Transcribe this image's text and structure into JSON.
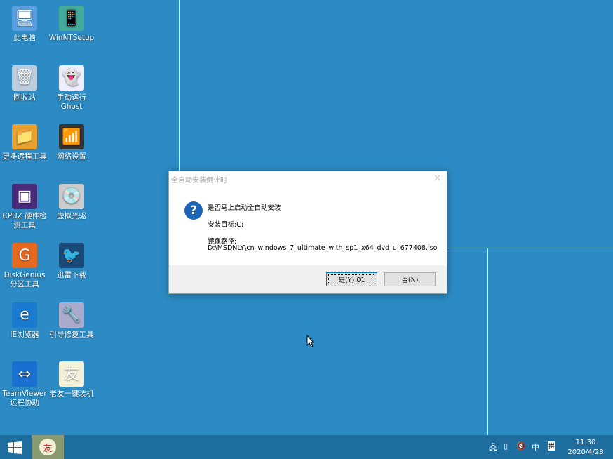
{
  "desktop_icons": [
    {
      "label": "此电脑",
      "glyph": "🖥"
    },
    {
      "label": "WinNTSetup",
      "glyph": "📱"
    },
    {
      "label": "回收站",
      "glyph": "🗑"
    },
    {
      "label": "手动运行Ghost",
      "glyph": "👻"
    },
    {
      "label": "更多远程工具",
      "glyph": "📁"
    },
    {
      "label": "网络设置",
      "glyph": "📶"
    },
    {
      "label": "CPUZ 硬件检测工具",
      "glyph": "▣"
    },
    {
      "label": "虚拟光驱",
      "glyph": "💿"
    },
    {
      "label": "DiskGenius分区工具",
      "glyph": "G"
    },
    {
      "label": "迅雷下载",
      "glyph": "🐦"
    },
    {
      "label": "IE浏览器",
      "glyph": "e"
    },
    {
      "label": "引导修复工具",
      "glyph": "🔧"
    },
    {
      "label": "TeamViewer远程协助",
      "glyph": "⇔"
    },
    {
      "label": "老友一键装机",
      "glyph": "友"
    }
  ],
  "dialog": {
    "title": "全自动安装倒计时",
    "close": "✕",
    "question": "是否马上启动全自动安装",
    "target": "安装目标:C:",
    "image_label": "镜像路径:",
    "image_path": "D:\\MSDNLY\\cn_windows_7_ultimate_with_sp1_x64_dvd_u_677408.iso",
    "yes_button": "是(Y) 01",
    "no_button": "否(N)"
  },
  "taskbar": {
    "time": "11:30",
    "date": "2020/4/28",
    "ime": "中",
    "ime_mode": "拼",
    "app_glyph": "友"
  }
}
